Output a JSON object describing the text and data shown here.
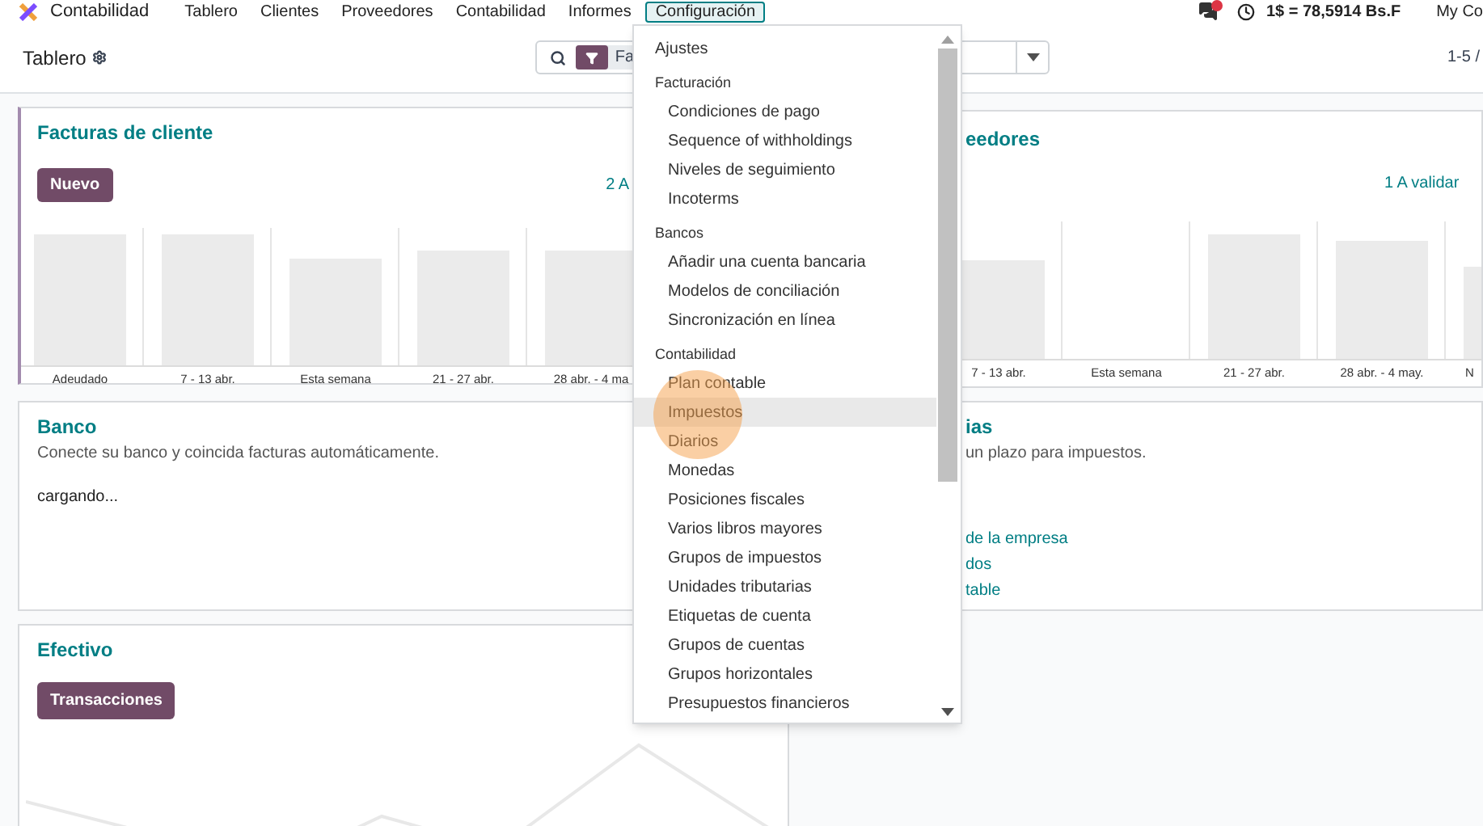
{
  "navbar": {
    "app_name": "Contabilidad",
    "menus": [
      {
        "label": "Tablero",
        "selected": false
      },
      {
        "label": "Clientes",
        "selected": false
      },
      {
        "label": "Proveedores",
        "selected": false
      },
      {
        "label": "Contabilidad",
        "selected": false
      },
      {
        "label": "Informes",
        "selected": false
      },
      {
        "label": "Configuración",
        "selected": true
      }
    ],
    "exchange_rate": "1$ = 78,5914 Bs.F",
    "company": "My Co"
  },
  "control_panel": {
    "title": "Tablero",
    "filter_text": "Fa",
    "pager": "1-5 /"
  },
  "customer_invoices": {
    "title": "Facturas de cliente",
    "button": "Nuevo",
    "link": "2 A",
    "columns": [
      "Adeudado",
      "7 - 13 abr.",
      "Esta semana",
      "21 - 27 abr.",
      "28 abr. - 4 ma"
    ]
  },
  "vendor_bills": {
    "title": "eedores",
    "link": "1 A validar",
    "columns": [
      "7 - 13 abr.",
      "Esta semana",
      "21 - 27 abr.",
      "28 abr. - 4 may.",
      "N"
    ]
  },
  "bank": {
    "title": "Banco",
    "description": "Conecte su banco y coincida facturas automáticamente.",
    "status": "cargando..."
  },
  "taxes": {
    "title": "ias",
    "description": "un plazo para impuestos.",
    "links": [
      "de la empresa",
      "dos",
      "table"
    ]
  },
  "cash": {
    "title": "Efectivo",
    "button": "Transacciones"
  },
  "config_menu": {
    "items": [
      {
        "kind": "item",
        "label": "Ajustes",
        "selected": false
      },
      {
        "kind": "header",
        "label": "Facturación"
      },
      {
        "kind": "subitem",
        "label": "Condiciones de pago",
        "selected": false
      },
      {
        "kind": "subitem",
        "label": "Sequence of withholdings",
        "selected": false
      },
      {
        "kind": "subitem",
        "label": "Niveles de seguimiento",
        "selected": false
      },
      {
        "kind": "subitem",
        "label": "Incoterms",
        "selected": false
      },
      {
        "kind": "header",
        "label": "Bancos"
      },
      {
        "kind": "subitem",
        "label": "Añadir una cuenta bancaria",
        "selected": false
      },
      {
        "kind": "subitem",
        "label": "Modelos de conciliación",
        "selected": false
      },
      {
        "kind": "subitem",
        "label": "Sincronización en línea",
        "selected": false
      },
      {
        "kind": "header",
        "label": "Contabilidad"
      },
      {
        "kind": "subitem",
        "label": "Plan contable",
        "selected": false
      },
      {
        "kind": "subitem",
        "label": "Impuestos",
        "selected": true
      },
      {
        "kind": "subitem",
        "label": "Diarios",
        "selected": false
      },
      {
        "kind": "subitem",
        "label": "Monedas",
        "selected": false
      },
      {
        "kind": "subitem",
        "label": "Posiciones fiscales",
        "selected": false
      },
      {
        "kind": "subitem",
        "label": "Varios libros mayores",
        "selected": false
      },
      {
        "kind": "subitem",
        "label": "Grupos de impuestos",
        "selected": false
      },
      {
        "kind": "subitem",
        "label": "Unidades tributarias",
        "selected": false
      },
      {
        "kind": "subitem",
        "label": "Etiquetas de cuenta",
        "selected": false
      },
      {
        "kind": "subitem",
        "label": "Grupos de cuentas",
        "selected": false
      },
      {
        "kind": "subitem",
        "label": "Grupos horizontales",
        "selected": false
      },
      {
        "kind": "subitem",
        "label": "Presupuestos financieros",
        "selected": false
      }
    ]
  }
}
